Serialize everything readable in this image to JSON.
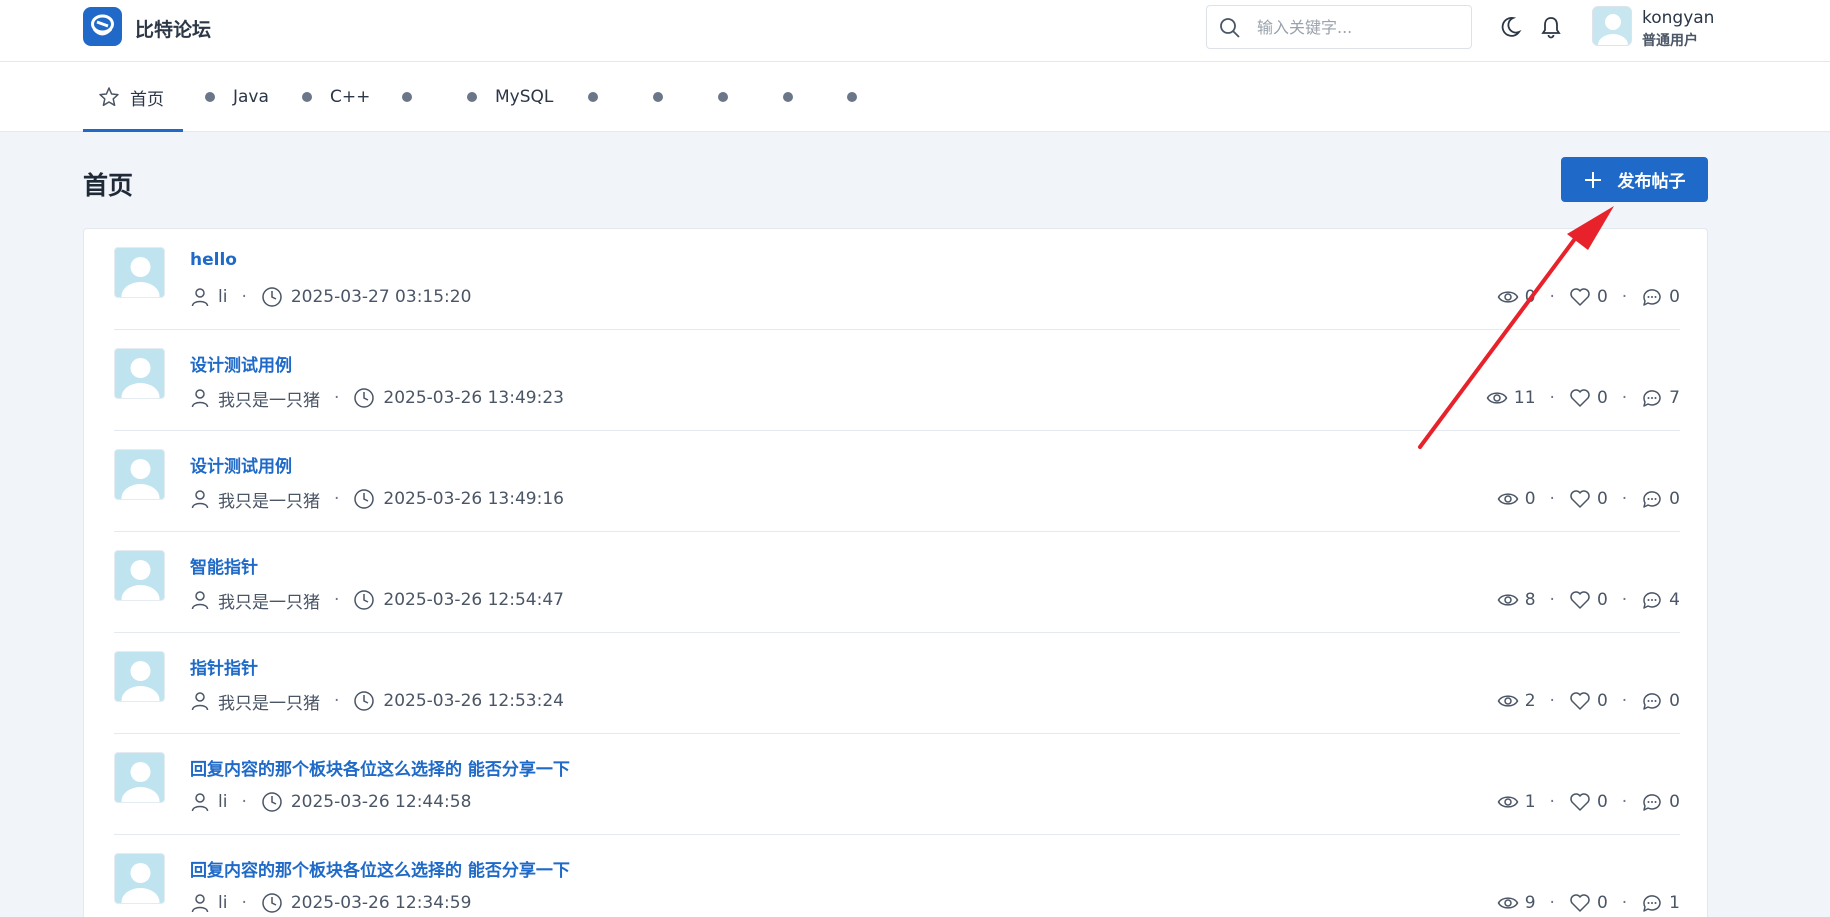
{
  "header": {
    "brand": "比特论坛",
    "search_placeholder": "输入关键字...",
    "user": {
      "name": "kongyan",
      "role": "普通用户"
    }
  },
  "nav": {
    "home": "首页",
    "items": [
      "Java",
      "C++",
      "",
      "MySQL",
      "",
      "",
      "",
      "",
      ""
    ]
  },
  "page": {
    "title": "首页",
    "post_button": "发布帖子"
  },
  "posts": [
    {
      "title": "hello",
      "author": "li",
      "time": "2025-03-27 03:15:20",
      "views": "0",
      "likes": "0",
      "comments": "0"
    },
    {
      "title": "设计测试用例",
      "author": "我只是一只猪",
      "time": "2025-03-26 13:49:23",
      "views": "11",
      "likes": "0",
      "comments": "7"
    },
    {
      "title": "设计测试用例",
      "author": "我只是一只猪",
      "time": "2025-03-26 13:49:16",
      "views": "0",
      "likes": "0",
      "comments": "0"
    },
    {
      "title": "智能指针",
      "author": "我只是一只猪",
      "time": "2025-03-26 12:54:47",
      "views": "8",
      "likes": "0",
      "comments": "4"
    },
    {
      "title": "指针指针",
      "author": "我只是一只猪",
      "time": "2025-03-26 12:53:24",
      "views": "2",
      "likes": "0",
      "comments": "0"
    },
    {
      "title": "回复内容的那个板块各位这么选择的 能否分享一下",
      "author": "li",
      "time": "2025-03-26 12:44:58",
      "views": "1",
      "likes": "0",
      "comments": "0"
    },
    {
      "title": "回复内容的那个板块各位这么选择的 能否分享一下",
      "author": "li",
      "time": "2025-03-26 12:34:59",
      "views": "9",
      "likes": "0",
      "comments": "1"
    }
  ],
  "colors": {
    "primary": "#1f6ac8",
    "annotation_arrow": "#e8222a"
  }
}
